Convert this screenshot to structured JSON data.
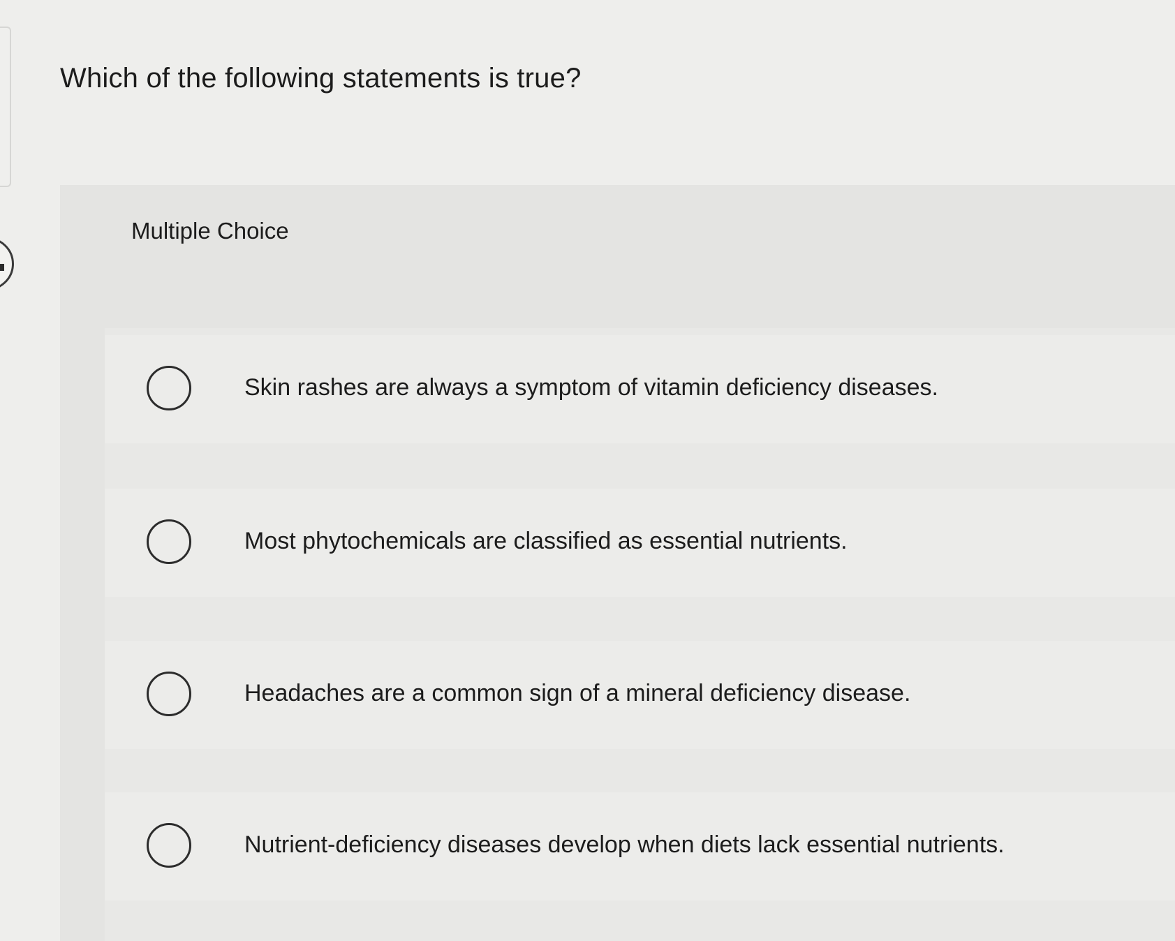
{
  "question": {
    "text": "Which of the following statements is true?",
    "type_label": "Multiple Choice"
  },
  "options": [
    {
      "label": "Skin rashes are always a symptom of vitamin deficiency diseases.",
      "selected": false
    },
    {
      "label": "Most phytochemicals are classified as essential nutrients.",
      "selected": false
    },
    {
      "label": "Headaches are a common sign of a mineral deficiency disease.",
      "selected": false
    },
    {
      "label": "Nutrient-deficiency diseases develop when diets lack essential nutrients.",
      "selected": false
    }
  ]
}
